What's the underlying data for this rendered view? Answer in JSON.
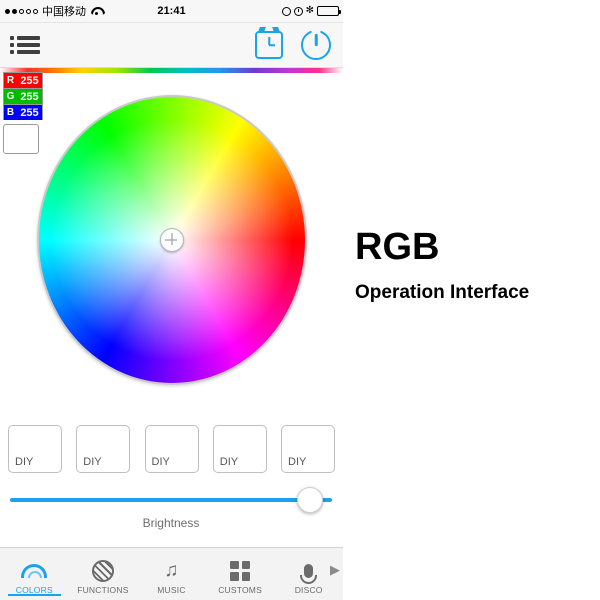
{
  "status_bar": {
    "signal_dots": [
      "filled",
      "filled",
      "hollow",
      "hollow",
      "hollow"
    ],
    "carrier": "中国移动",
    "wifi_icon": "wifi-icon",
    "time": "21:41",
    "lock_icon": "rotation-lock-icon",
    "alarm_icon": "alarm-clock-icon",
    "bluetooth_icon": "bluetooth-icon",
    "bluetooth_glyph": "✻",
    "battery_level": 75
  },
  "nav_bar": {
    "menu_icon": "hamburger-menu-icon",
    "timer_icon": "timer-icon",
    "power_icon": "power-icon"
  },
  "rgb_readout": {
    "channels": [
      {
        "name": "R",
        "value": "255"
      },
      {
        "name": "G",
        "value": "255"
      },
      {
        "name": "B",
        "value": "255"
      }
    ],
    "swatch_color": "#ffffff"
  },
  "color_wheel": {
    "cursor_icon": "crosshair-cursor-icon",
    "selected_color": "#ffffff"
  },
  "diy_buttons": [
    {
      "label": "DIY"
    },
    {
      "label": "DIY"
    },
    {
      "label": "DIY"
    },
    {
      "label": "DIY"
    },
    {
      "label": "DIY"
    }
  ],
  "brightness": {
    "label": "Brightness",
    "value": 90
  },
  "tab_bar": {
    "more_arrow": "▶",
    "tabs": [
      {
        "label": "COLORS",
        "icon": "rainbow-icon",
        "active": true
      },
      {
        "label": "FUNCTIONS",
        "icon": "striped-circle-icon",
        "active": false
      },
      {
        "label": "MUSIC",
        "icon": "music-note-icon",
        "active": false
      },
      {
        "label": "CUSTOMS",
        "icon": "grid-squares-icon",
        "active": false
      },
      {
        "label": "DISCO",
        "icon": "microphone-icon",
        "active": false
      }
    ]
  },
  "caption": {
    "title": "RGB",
    "subtitle": "Operation Interface"
  },
  "colors": {
    "accent": "#1aa3e8",
    "red": "#ff0000",
    "green": "#00bb00",
    "blue": "#0000ff",
    "bar_bg": "#f7f7f7"
  }
}
